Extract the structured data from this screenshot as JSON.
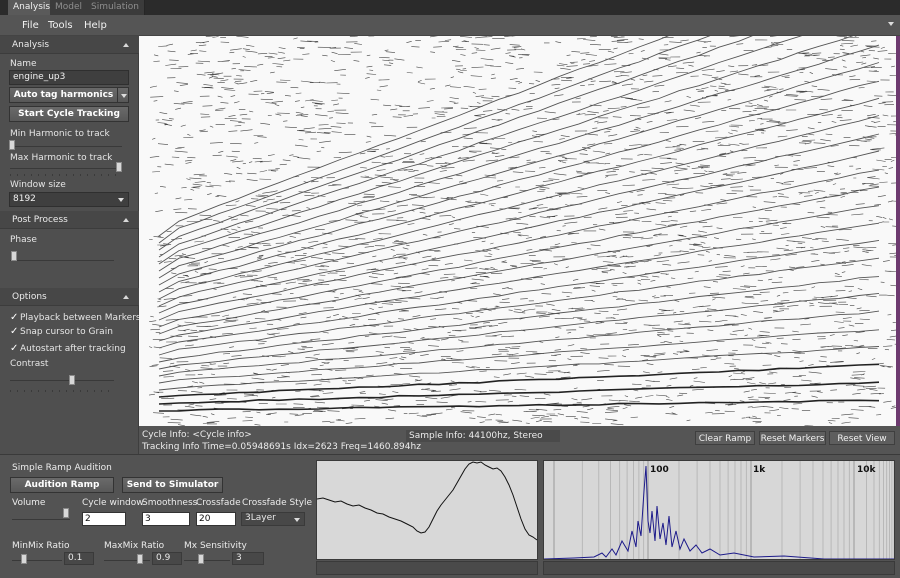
{
  "tabs": [
    "Analysis",
    "Model",
    "Simulation"
  ],
  "menu": [
    "File",
    "Tools",
    "Help"
  ],
  "analysis": {
    "header": "Analysis",
    "name_label": "Name",
    "name_value": "engine_up3",
    "auto_tag_label": "Auto tag harmonics",
    "start_tracking_label": "Start Cycle Tracking",
    "min_harmonic_label": "Min Harmonic to track",
    "max_harmonic_label": "Max Harmonic to track",
    "window_size_label": "Window size",
    "window_size_value": "8192"
  },
  "post_process": {
    "header": "Post Process",
    "phase_label": "Phase"
  },
  "options": {
    "header": "Options",
    "checks": [
      "Playback between Markers",
      "Snap cursor to Grain",
      "Autostart after tracking"
    ],
    "contrast_label": "Contrast"
  },
  "info": {
    "cycle_info": "Cycle Info: <Cycle info>",
    "tracking_info": "Tracking Info Time=0.05948691s Idx=2623 Freq=1460.894hz",
    "sample_info": "Sample Info: 44100hz, Stereo"
  },
  "toolbar": {
    "clear_ramp": "Clear Ramp",
    "reset_markers": "Reset Markers",
    "reset_view": "Reset View"
  },
  "audition": {
    "title": "Simple Ramp Audition",
    "audition_button": "Audition Ramp",
    "send_button": "Send to Simulator",
    "volume_label": "Volume",
    "cycle_window_label": "Cycle window",
    "cycle_window_value": "2",
    "smoothness_label": "Smoothness",
    "smoothness_value": "3",
    "crossfade_label": "Crossfade",
    "crossfade_value": "20",
    "crossfade_style_label": "Crossfade Style",
    "crossfade_style_value": "3Layer",
    "minmix_label": "MinMix Ratio",
    "minmix_value": "0.1",
    "maxmix_label": "MaxMix Ratio",
    "maxmix_value": "0.9",
    "mx_sens_label": "Mx Sensitivity",
    "mx_sens_value": "3"
  },
  "fft": {
    "labels": [
      "100",
      "1k",
      "10k"
    ]
  }
}
